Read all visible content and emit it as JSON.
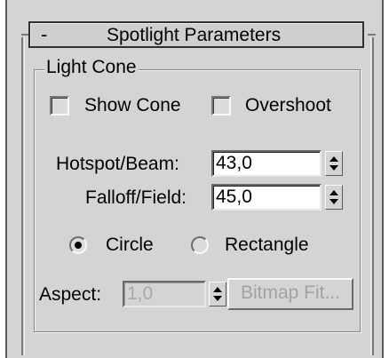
{
  "rollout": {
    "collapse_symbol": "-",
    "title": "Spotlight Parameters"
  },
  "light_cone": {
    "group_label": "Light Cone",
    "show_cone_label": "Show Cone",
    "show_cone_checked": false,
    "overshoot_label": "Overshoot",
    "overshoot_checked": false,
    "hotspot_label": "Hotspot/Beam:",
    "hotspot_value": "43,0",
    "falloff_label": "Falloff/Field:",
    "falloff_value": "45,0",
    "shape_options": [
      "Circle",
      "Rectangle"
    ],
    "shape_selected": "Circle",
    "aspect_label": "Aspect:",
    "aspect_value": "1,0",
    "aspect_enabled": false,
    "bitmap_fit_label": "Bitmap Fit...",
    "bitmap_fit_enabled": false
  },
  "icons": [
    "spinner-up-icon",
    "spinner-down-icon"
  ]
}
